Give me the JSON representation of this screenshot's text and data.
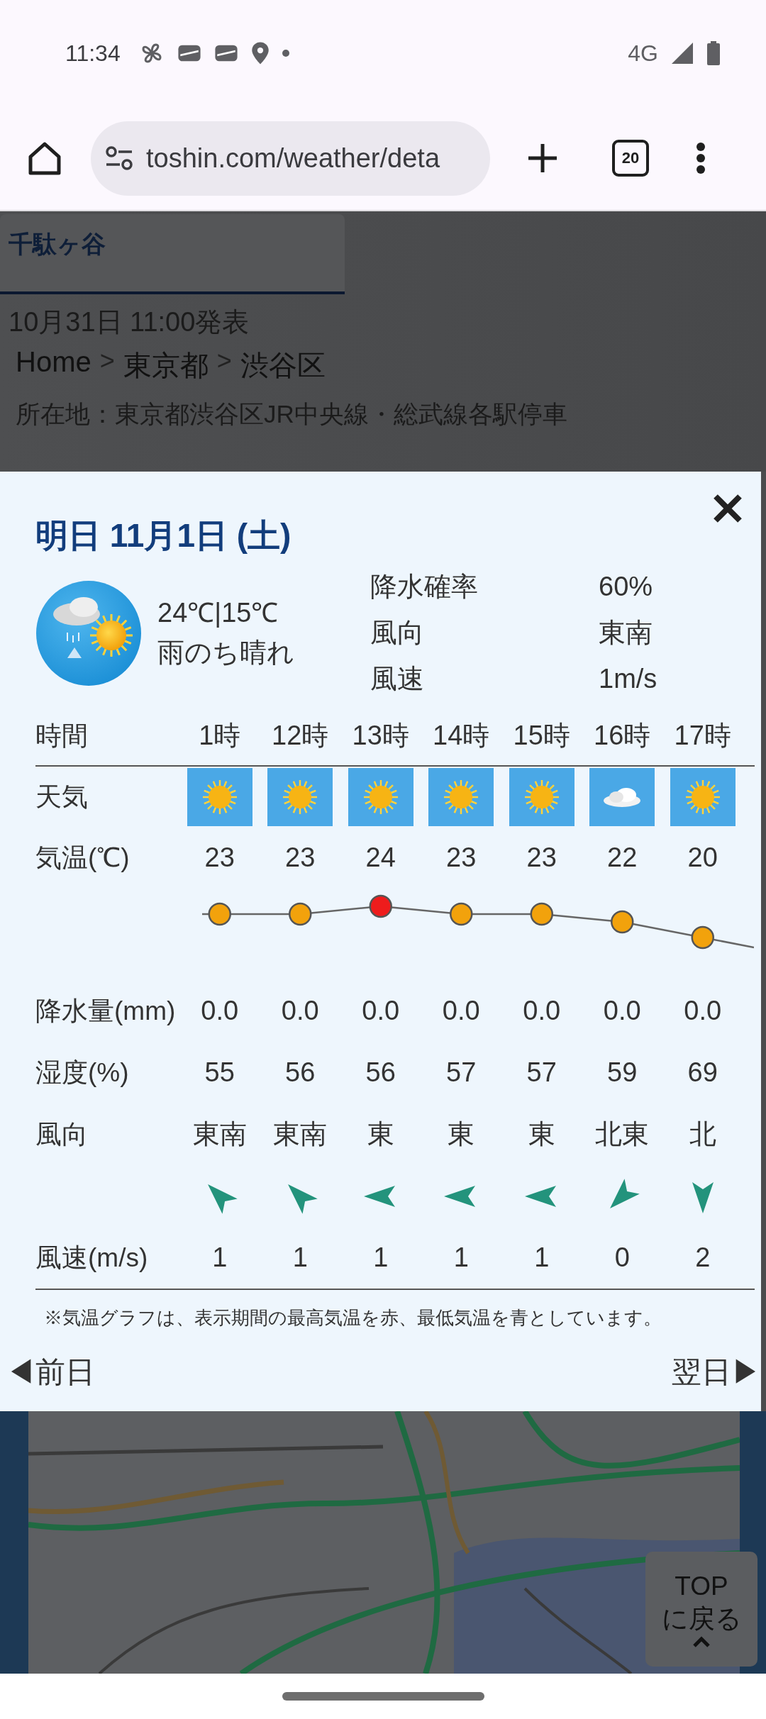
{
  "status_bar": {
    "time": "11:34",
    "network": "4G"
  },
  "browser": {
    "url": "toshin.com/weather/deta",
    "tab_count": "20"
  },
  "page": {
    "tab": {
      "label": "千駄ヶ谷",
      "selected": true
    },
    "issued": "10月31日 11:00発表",
    "breadcrumb": [
      {
        "kind": "link",
        "label": "Home"
      },
      {
        "kind": "separator",
        "label": ">"
      },
      {
        "kind": "link",
        "label": "東京都"
      },
      {
        "kind": "separator",
        "label": ">"
      },
      {
        "kind": "link",
        "label": "渋谷区"
      }
    ],
    "address": "所在地：東京都渋谷区JR中央線・総武線各駅停車"
  },
  "modal": {
    "title": "明日 11月1日 (土)",
    "temperatures": "24℃|15℃",
    "weather": "雨のち晴れ",
    "details": [
      {
        "label": "降水確率",
        "value": "60%"
      },
      {
        "label": "風向",
        "value": "東南"
      },
      {
        "label": "風速",
        "value": "1m/s"
      }
    ],
    "row_labels": {
      "time": "時間",
      "weather": "天気",
      "temperature": "気温(℃)",
      "precipitation": "降水量(mm)",
      "humidity": "湿度(%)",
      "wind_direction": "風向",
      "wind_speed": "風速(m/s)"
    },
    "hours": [
      {
        "time": "1時",
        "kind": "sunny",
        "temperature": "23",
        "color": "#f2a20c",
        "precipitation": "0.0",
        "humidity": "55",
        "wind_direction": "東南",
        "wind_arrow": {
          "kind": "northwest"
        },
        "wind_speed": "1"
      },
      {
        "time": "12時",
        "kind": "sunny",
        "temperature": "23",
        "color": "#f2a20c",
        "precipitation": "0.0",
        "humidity": "56",
        "wind_direction": "東南",
        "wind_arrow": {
          "kind": "northwest"
        },
        "wind_speed": "1"
      },
      {
        "time": "13時",
        "kind": "sunny",
        "temperature": "24",
        "color": "#ee1c1c",
        "precipitation": "0.0",
        "humidity": "56",
        "wind_direction": "東",
        "wind_arrow": {
          "kind": "west"
        },
        "wind_speed": "1"
      },
      {
        "time": "14時",
        "kind": "sunny",
        "temperature": "23",
        "color": "#f2a20c",
        "precipitation": "0.0",
        "humidity": "57",
        "wind_direction": "東",
        "wind_arrow": {
          "kind": "west"
        },
        "wind_speed": "1"
      },
      {
        "time": "15時",
        "kind": "sunny",
        "temperature": "23",
        "color": "#f2a20c",
        "precipitation": "0.0",
        "humidity": "57",
        "wind_direction": "東",
        "wind_arrow": {
          "kind": "west"
        },
        "wind_speed": "1"
      },
      {
        "time": "16時",
        "kind": "cloudy",
        "temperature": "22",
        "color": "#f2a20c",
        "precipitation": "0.0",
        "humidity": "59",
        "wind_direction": "北東",
        "wind_arrow": {
          "kind": "southwest"
        },
        "wind_speed": "0"
      },
      {
        "time": "17時",
        "kind": "sunny",
        "temperature": "20",
        "color": "#f2a20c",
        "precipitation": "0.0",
        "humidity": "69",
        "wind_direction": "北",
        "wind_arrow": {
          "kind": "south"
        },
        "wind_speed": "2"
      }
    ],
    "footnote": "※気温グラフは、表示期間の最高気温を赤、最低気温を青としています。",
    "prev": "◀前日",
    "next": "翌日▶"
  },
  "top_button": {
    "lines": [
      "TOP",
      "に戻る"
    ]
  }
}
